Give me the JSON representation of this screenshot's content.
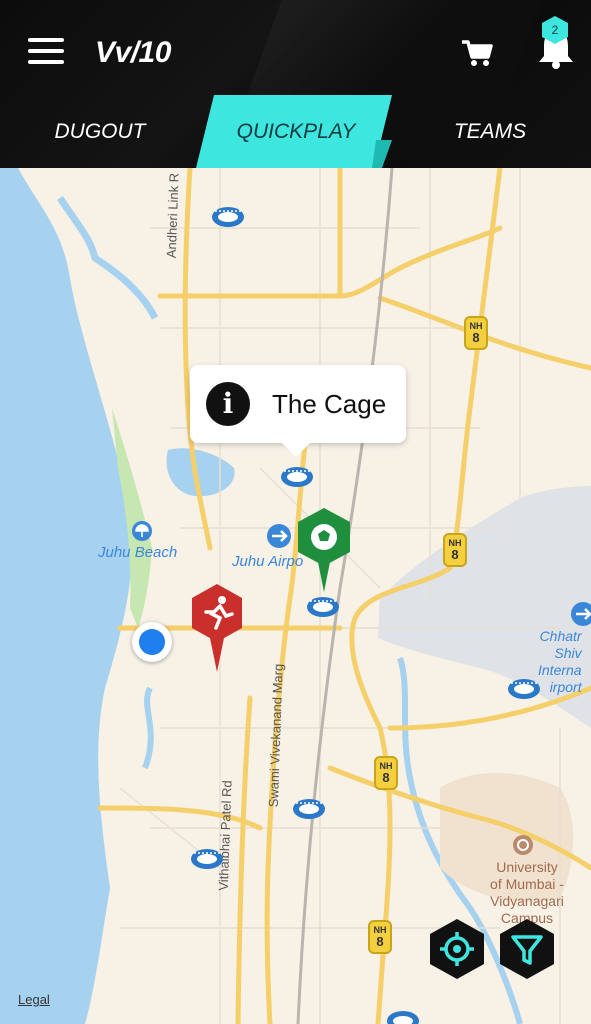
{
  "header": {
    "brand": "Vv/10",
    "notification_count": "2",
    "tabs": [
      {
        "label": "DUGOUT",
        "active": false
      },
      {
        "label": "QUICKPLAY",
        "active": true
      },
      {
        "label": "TEAMS",
        "active": false
      }
    ],
    "accent_color": "#3ee6e0"
  },
  "map": {
    "callout": {
      "title": "The Cage",
      "icon": "info-icon"
    },
    "labels": {
      "juhu_beach": "Juhu Beach",
      "juhu_airport": "Juhu Airpo",
      "airport_intl": [
        "Chhatr",
        "Shiv",
        "Interna",
        "irport"
      ],
      "university": [
        "University",
        "of Mumbai -",
        "Vidyanagari",
        "Campus"
      ]
    },
    "roads": {
      "andheri_link": "Andheri Link R",
      "swami_vivekanand": "Swami Vivekanand Marg",
      "vithalbhai_patel": "Vithalbhai Patel Rd"
    },
    "highway_shield": {
      "top": "NH",
      "number": "8"
    },
    "legal": "Legal",
    "markers": [
      {
        "type": "football-pin",
        "color": "#1f8f3e"
      },
      {
        "type": "running-pin",
        "color": "#c9302c"
      },
      {
        "type": "current-location",
        "color": "#1f7ef0"
      }
    ]
  },
  "actions": {
    "locate_icon": "crosshair-icon",
    "filter_icon": "filter-icon"
  }
}
